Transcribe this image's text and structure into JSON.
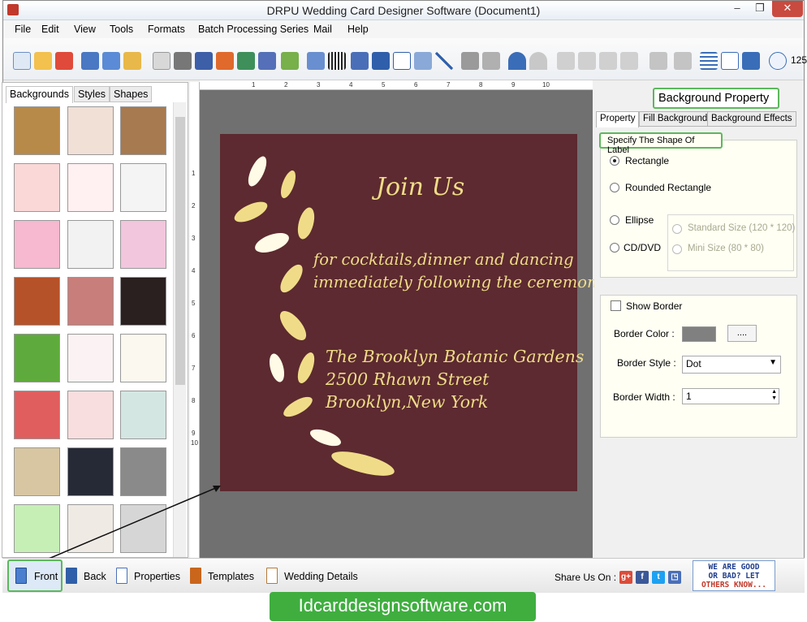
{
  "window": {
    "title": "DRPU Wedding Card Designer Software (Document1)",
    "min_label": "–",
    "max_label": "❐",
    "close_label": "✕"
  },
  "menu": [
    "File",
    "Edit",
    "View",
    "Tools",
    "Formats",
    "Batch Processing Series",
    "Mail",
    "Help"
  ],
  "toolbar": {
    "zoom_value": "125"
  },
  "left_panel": {
    "tabs": [
      "Backgrounds",
      "Styles",
      "Shapes"
    ],
    "active_tab": "Backgrounds"
  },
  "rulers": {
    "top_ticks": [
      "1",
      "2",
      "3",
      "4",
      "5",
      "6",
      "7",
      "8",
      "9",
      "10"
    ],
    "left_ticks": [
      "1",
      "2",
      "3",
      "4",
      "5",
      "6",
      "7",
      "8",
      "9",
      "10"
    ]
  },
  "card": {
    "heading": "Join Us",
    "line1": "for cocktails,dinner and dancing",
    "line2": "immediately following the ceremony",
    "venue": "The Brooklyn Botanic Gardens",
    "street": "2500 Rhawn Street",
    "city": "Brooklyn,New York",
    "bg_color": "#5c2a30",
    "text_color": "#f0dc88"
  },
  "right_panel": {
    "title": "Background Property",
    "tabs": [
      "Property",
      "Fill Background",
      "Background Effects"
    ],
    "active_tab": "Property",
    "shape_group_label": "Specify The Shape Of Label",
    "shapes": {
      "rectangle": "Rectangle",
      "rounded": "Rounded Rectangle",
      "ellipse": "Ellipse",
      "cddvd": "CD/DVD",
      "standard": "Standard Size (120 * 120)",
      "mini": "Mini Size (80 * 80)"
    },
    "selected_shape": "Rectangle",
    "show_border_label": "Show Border",
    "show_border_checked": false,
    "border_color_label": "Border Color :",
    "border_color": "#808080",
    "border_color_button": "....",
    "border_style_label": "Border Style :",
    "border_style_value": "Dot",
    "border_width_label": "Border Width :",
    "border_width_value": "1"
  },
  "bottom_bar": {
    "front": "Front",
    "back": "Back",
    "properties": "Properties",
    "templates": "Templates",
    "wedding_details": "Wedding Details",
    "share_label": "Share Us On :",
    "gb_line1": "WE ARE GOOD",
    "gb_line2": "OR BAD? LET",
    "gb_line3": "OTHERS KNOW..."
  },
  "site": {
    "banner": "Idcarddesignsoftware.com"
  }
}
